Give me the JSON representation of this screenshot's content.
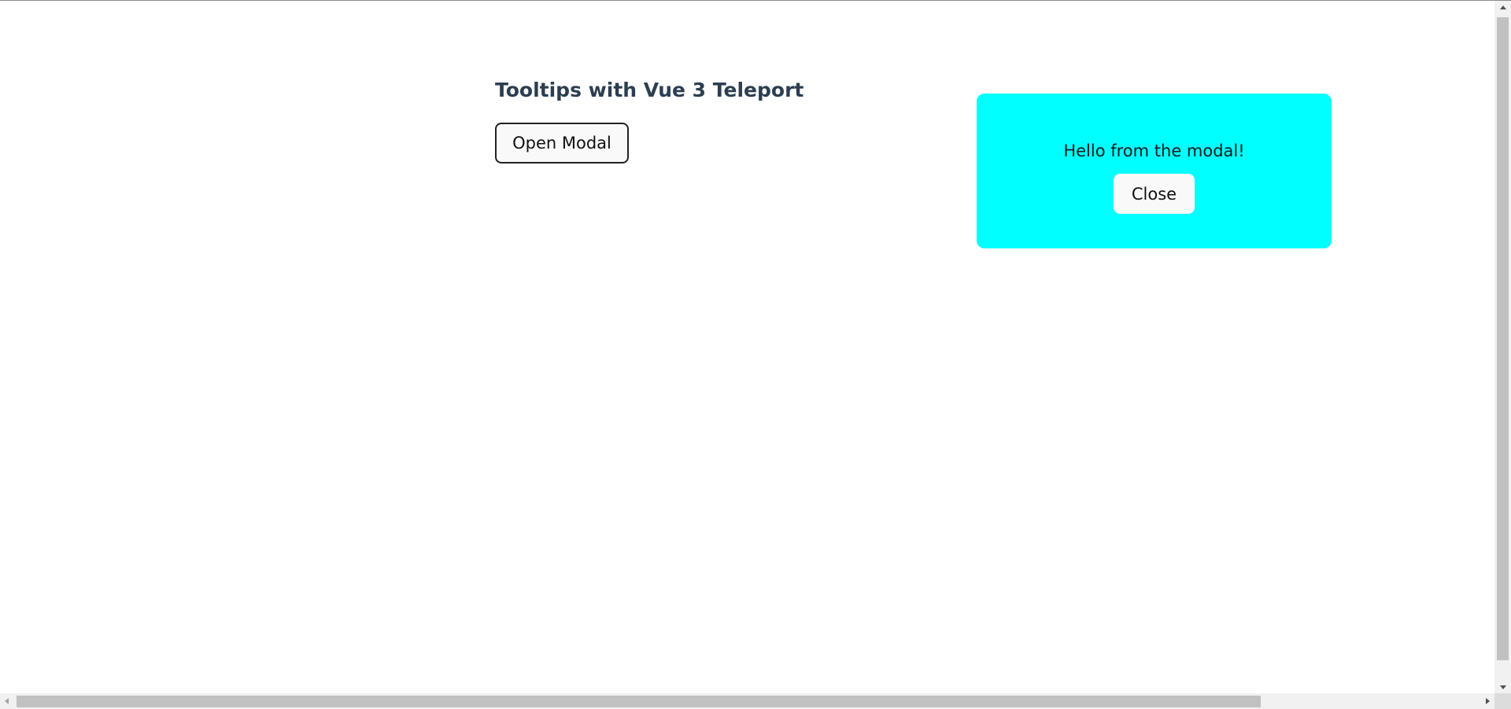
{
  "page": {
    "title": "Tooltips with Vue 3 Teleport",
    "open_button_label": "Open Modal"
  },
  "modal": {
    "message": "Hello from the modal!",
    "close_button_label": "Close",
    "background_color": "#00ffff"
  },
  "icons": {
    "scroll_up": "chevron-up-icon",
    "scroll_down": "chevron-down-icon",
    "scroll_left": "chevron-left-icon",
    "scroll_right": "chevron-right-icon"
  }
}
